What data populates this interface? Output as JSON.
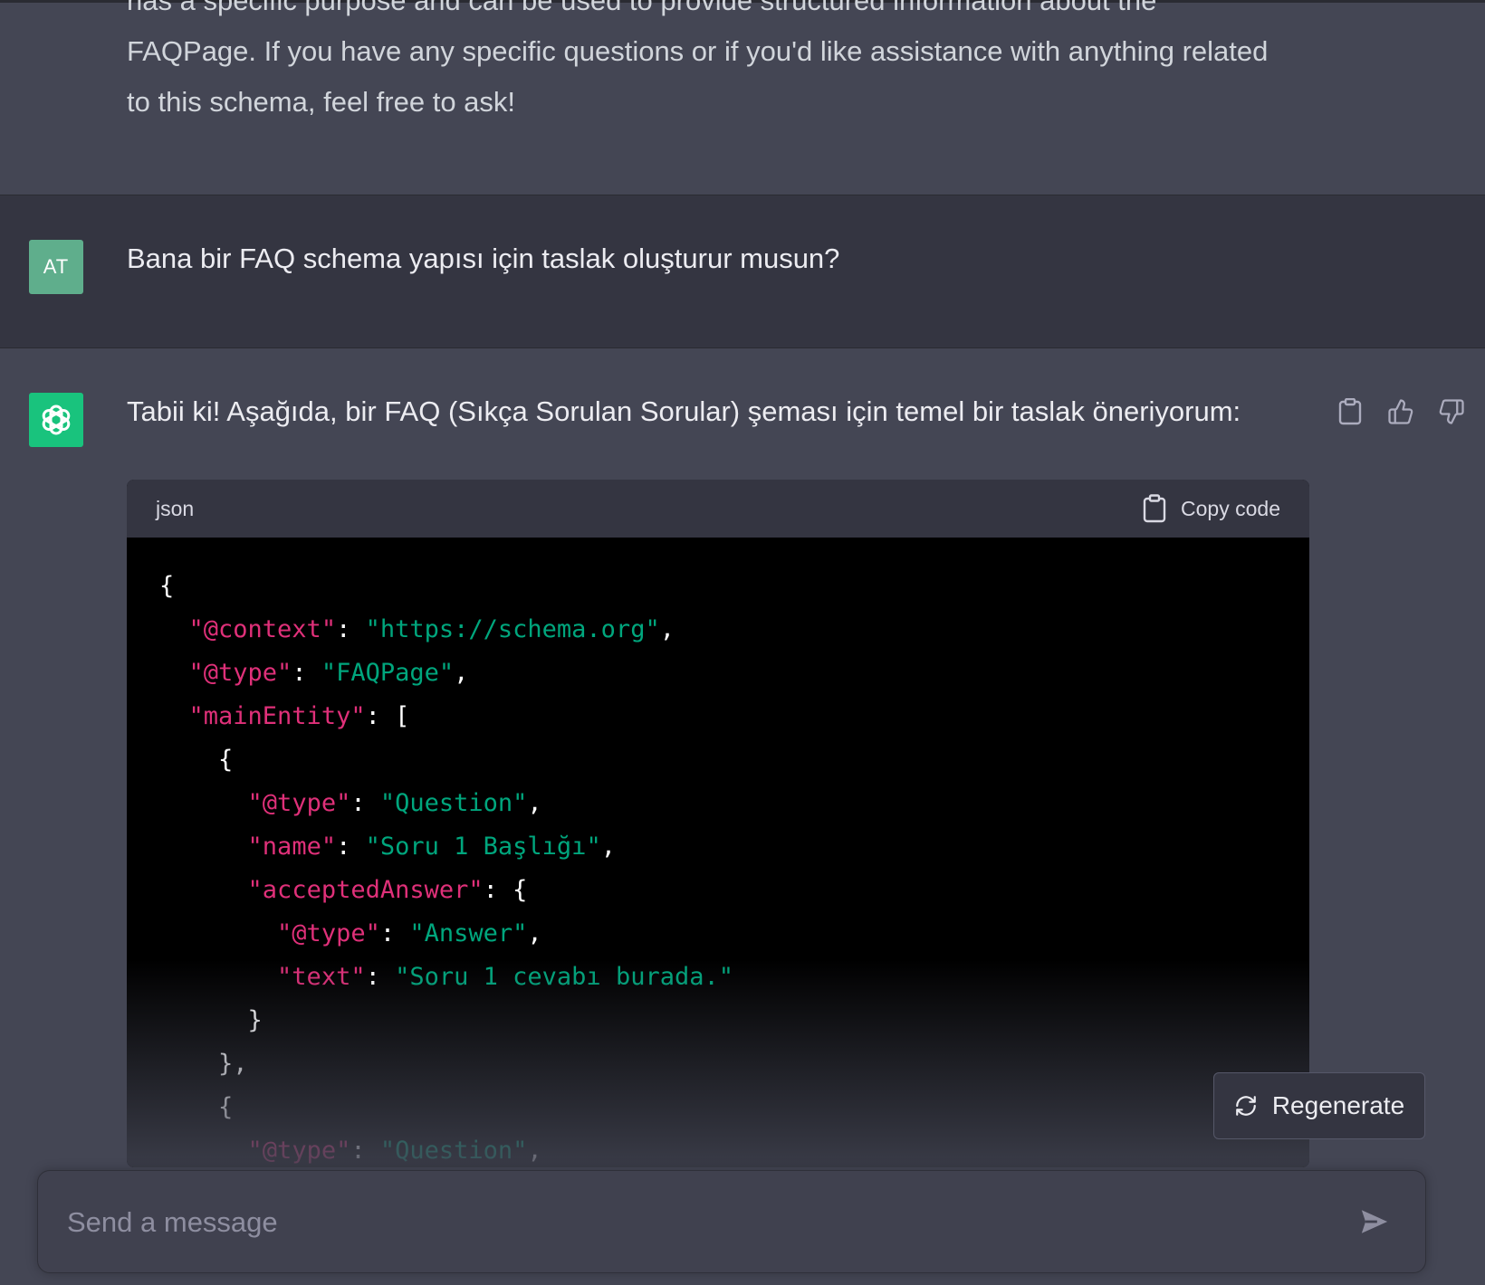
{
  "previous_message": {
    "lines": [
      "has a specific purpose and can be used to provide structured information about the",
      "FAQPage. If you have any specific questions or if you'd like assistance with anything related",
      "to this schema, feel free to ask!"
    ]
  },
  "user_message": {
    "avatar_initials": "AT",
    "text": "Bana bir FAQ schema yapısı için taslak oluşturur musun?"
  },
  "assistant_message": {
    "intro": "Tabii ki! Aşağıda, bir FAQ (Sıkça Sorulan Sorular) şeması için temel bir taslak öneriyorum:",
    "actions": [
      "clipboard-icon",
      "thumbs-up-icon",
      "thumbs-down-icon"
    ],
    "code_block": {
      "language": "json",
      "copy_label": "Copy code",
      "lines": [
        [
          {
            "t": "{",
            "c": "p"
          }
        ],
        [
          {
            "t": "  ",
            "c": "p"
          },
          {
            "t": "\"@context\"",
            "c": "key"
          },
          {
            "t": ": ",
            "c": "p"
          },
          {
            "t": "\"https://schema.org\"",
            "c": "str"
          },
          {
            "t": ",",
            "c": "p"
          }
        ],
        [
          {
            "t": "  ",
            "c": "p"
          },
          {
            "t": "\"@type\"",
            "c": "key"
          },
          {
            "t": ": ",
            "c": "p"
          },
          {
            "t": "\"FAQPage\"",
            "c": "str"
          },
          {
            "t": ",",
            "c": "p"
          }
        ],
        [
          {
            "t": "  ",
            "c": "p"
          },
          {
            "t": "\"mainEntity\"",
            "c": "key"
          },
          {
            "t": ": [",
            "c": "p"
          }
        ],
        [
          {
            "t": "    {",
            "c": "p"
          }
        ],
        [
          {
            "t": "      ",
            "c": "p"
          },
          {
            "t": "\"@type\"",
            "c": "key"
          },
          {
            "t": ": ",
            "c": "p"
          },
          {
            "t": "\"Question\"",
            "c": "str"
          },
          {
            "t": ",",
            "c": "p"
          }
        ],
        [
          {
            "t": "      ",
            "c": "p"
          },
          {
            "t": "\"name\"",
            "c": "key"
          },
          {
            "t": ": ",
            "c": "p"
          },
          {
            "t": "\"Soru 1 Başlığı\"",
            "c": "str"
          },
          {
            "t": ",",
            "c": "p"
          }
        ],
        [
          {
            "t": "      ",
            "c": "p"
          },
          {
            "t": "\"acceptedAnswer\"",
            "c": "key"
          },
          {
            "t": ": {",
            "c": "p"
          }
        ],
        [
          {
            "t": "        ",
            "c": "p"
          },
          {
            "t": "\"@type\"",
            "c": "key"
          },
          {
            "t": ": ",
            "c": "p"
          },
          {
            "t": "\"Answer\"",
            "c": "str"
          },
          {
            "t": ",",
            "c": "p"
          }
        ],
        [
          {
            "t": "        ",
            "c": "p"
          },
          {
            "t": "\"text\"",
            "c": "key"
          },
          {
            "t": ": ",
            "c": "p"
          },
          {
            "t": "\"Soru 1 cevabı burada.\"",
            "c": "str"
          }
        ],
        [
          {
            "t": "      }",
            "c": "p"
          }
        ],
        [
          {
            "t": "    },",
            "c": "p"
          }
        ],
        [
          {
            "t": "    {",
            "c": "p"
          }
        ],
        [
          {
            "t": "      ",
            "c": "p"
          },
          {
            "t": "\"@type\"",
            "c": "key"
          },
          {
            "t": ": ",
            "c": "p"
          },
          {
            "t": "\"Question\"",
            "c": "str"
          },
          {
            "t": ",",
            "c": "p"
          }
        ]
      ]
    }
  },
  "regenerate": {
    "label": "Regenerate"
  },
  "composer": {
    "placeholder": "Send a message",
    "value": ""
  },
  "colors": {
    "user_avatar": "#5fae8c",
    "assistant_avatar": "#19c37d",
    "code_key": "#df3079",
    "code_string": "#00a67d",
    "code_background": "#000000"
  }
}
